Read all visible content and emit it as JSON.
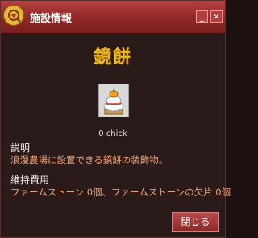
{
  "window": {
    "title": "施設情報",
    "minimize_icon": "minimize-icon",
    "close_icon": "close-icon"
  },
  "item": {
    "name": "鏡餅",
    "icon": "kagami-mochi-icon",
    "price": "0 chick"
  },
  "description": {
    "label": "説明",
    "text": "浪漫農場に設置できる鏡餅の装飾物。"
  },
  "maintenance": {
    "label": "維持費用",
    "text": "ファームストーン 0個、ファームストーンの欠片 0個"
  },
  "buttons": {
    "close_label": "閉じる"
  },
  "colors": {
    "titlebar": "#8c2625",
    "heading": "#f0b820",
    "body_text": "#f0a070"
  }
}
